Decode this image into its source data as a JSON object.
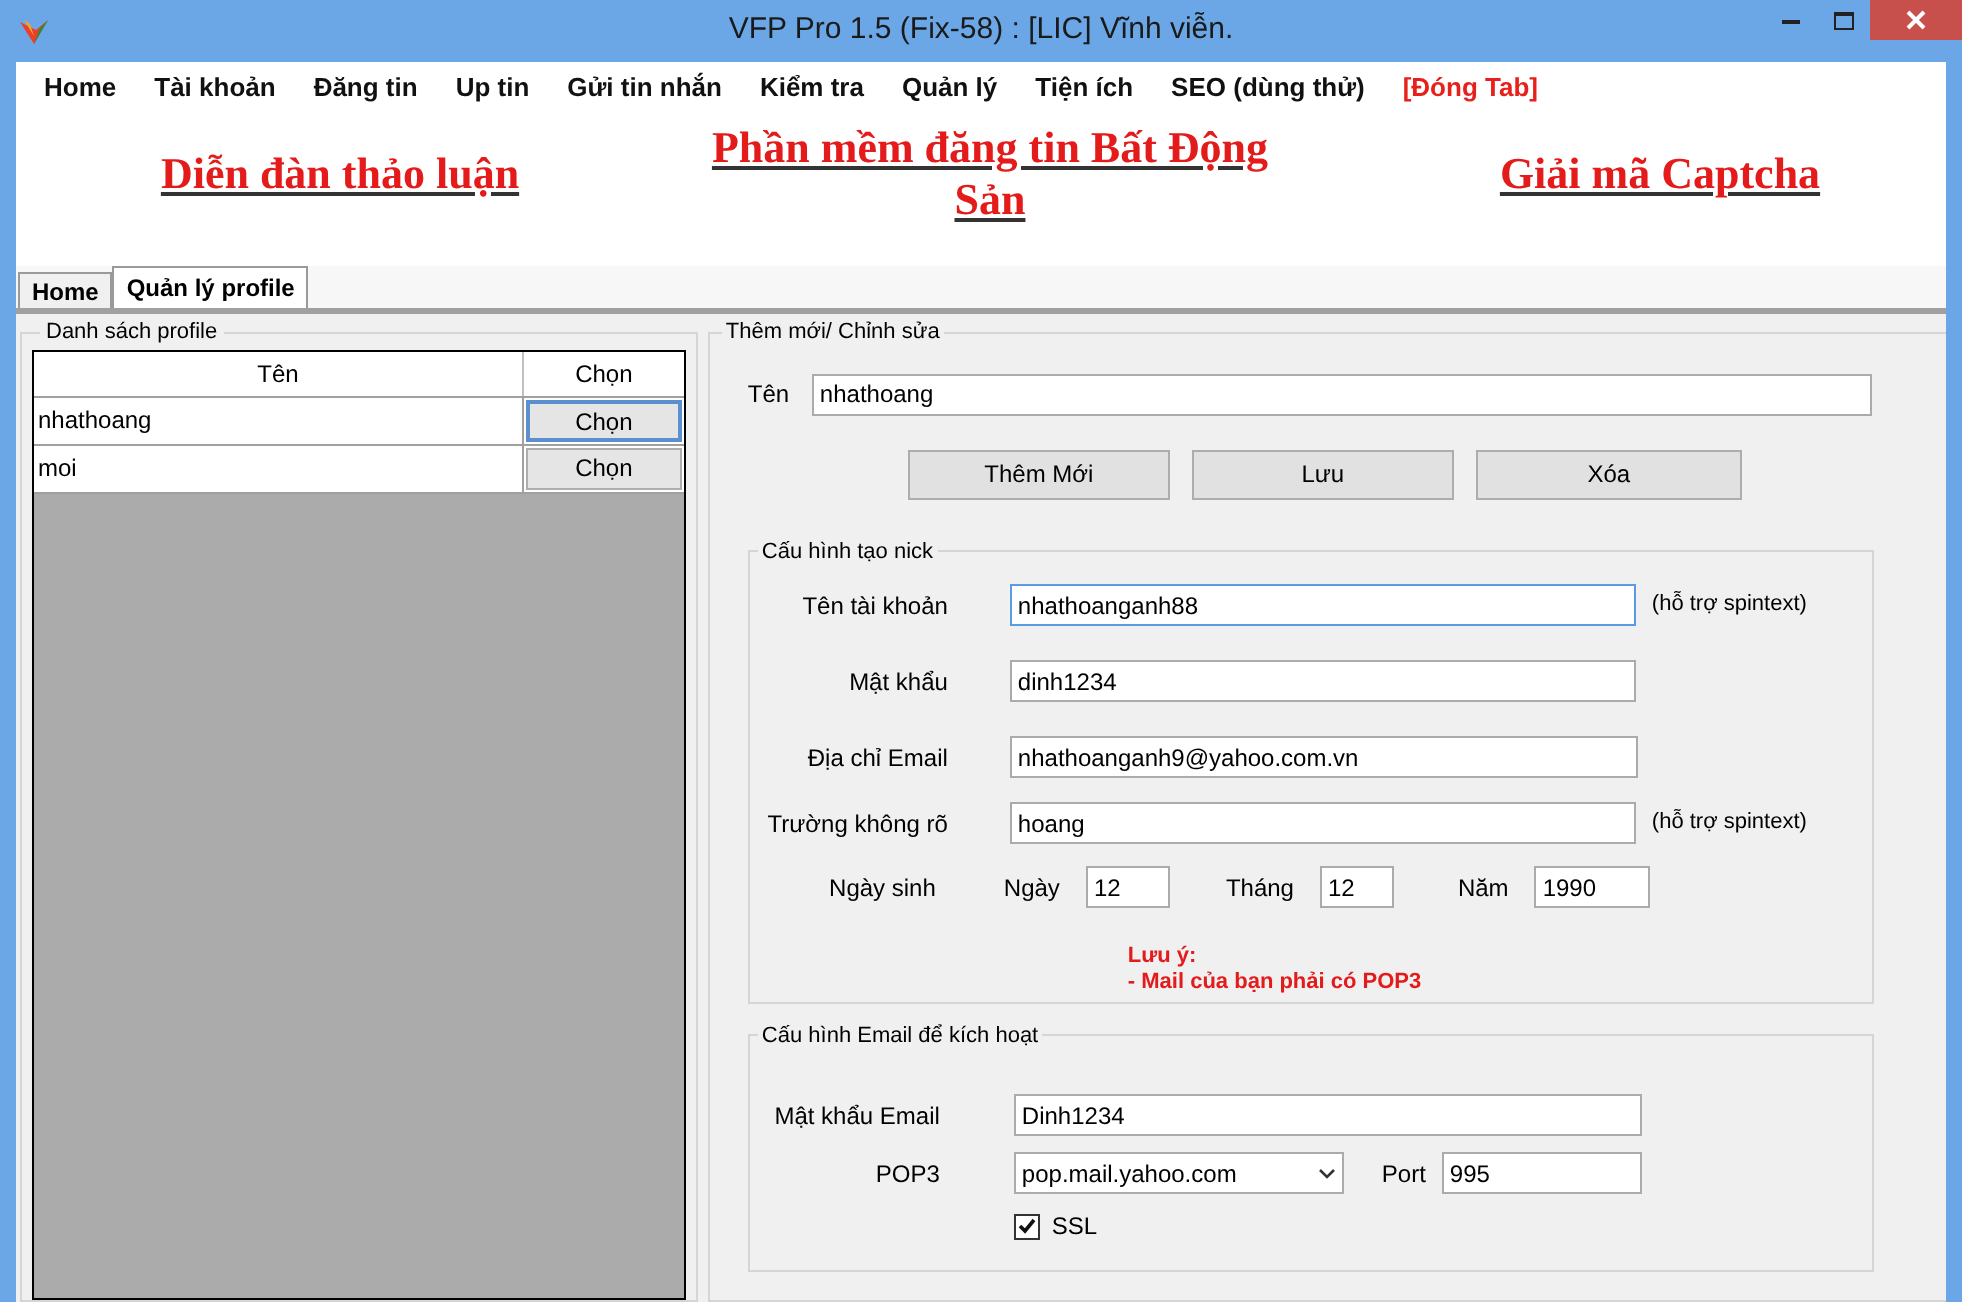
{
  "window": {
    "title": "VFP Pro 1.5 (Fix-58) : [LIC] Vĩnh viễn."
  },
  "menu": [
    {
      "label": "Home",
      "kind": "normal"
    },
    {
      "label": "Tài khoản",
      "kind": "normal"
    },
    {
      "label": "Đăng tin",
      "kind": "normal"
    },
    {
      "label": "Up tin",
      "kind": "normal"
    },
    {
      "label": "Gửi tin nhắn",
      "kind": "normal"
    },
    {
      "label": "Kiểm tra",
      "kind": "normal"
    },
    {
      "label": "Quản lý",
      "kind": "normal"
    },
    {
      "label": "Tiện ích",
      "kind": "normal"
    },
    {
      "label": "SEO (dùng thử)",
      "kind": "normal"
    },
    {
      "label": "[Đóng Tab]",
      "kind": "highlight"
    }
  ],
  "banner_links": [
    "Diễn đàn thảo luận",
    "Phần mềm đăng tin Bất Động Sản",
    "Giải mã Captcha"
  ],
  "tabs": [
    {
      "label": "Home",
      "selected": false
    },
    {
      "label": "Quản lý profile",
      "selected": true
    }
  ],
  "profile_list": {
    "title": "Danh sách profile",
    "columns": [
      "Tên",
      "Chọn"
    ],
    "rows": [
      {
        "name": "nhathoang",
        "button": "Chọn",
        "selected": true
      },
      {
        "name": "moi",
        "button": "Chọn",
        "selected": false
      }
    ]
  },
  "edit_group": {
    "title": "Thêm mới/ Chỉnh sửa",
    "name_label": "Tên",
    "name_value": "nhathoang",
    "buttons": [
      "Thêm Mới",
      "Lưu",
      "Xóa"
    ],
    "nick_config": {
      "title": "Cấu hình tạo nick",
      "fields": [
        {
          "label": "Tên tài khoản",
          "value": "nhathoanganh88",
          "hint": "(hỗ trợ spintext)",
          "focused": true
        },
        {
          "label": "Mật khẩu",
          "value": "dinh1234",
          "focused": false
        },
        {
          "label": "Địa chỉ Email",
          "value": "nhathoanganh9@yahoo.com.vn",
          "focused": false
        },
        {
          "label": "Trường không rõ",
          "value": "hoang",
          "hint": "(hỗ trợ spintext)",
          "focused": false
        }
      ],
      "birth": {
        "label": "Ngày sinh",
        "parts": [
          {
            "label": "Ngày",
            "value": "12"
          },
          {
            "label": "Tháng",
            "value": "12"
          },
          {
            "label": "Năm",
            "value": "1990"
          }
        ]
      },
      "note_lines": [
        "Lưu ý:",
        "- Mail của bạn phải có POP3"
      ]
    },
    "email_config": {
      "title": "Cấu hình Email để kích hoạt",
      "password": {
        "label": "Mật khẩu Email",
        "value": "Dinh1234"
      },
      "pop3": {
        "label": "POP3",
        "value": "pop.mail.yahoo.com"
      },
      "port": {
        "label": "Port",
        "value": "995"
      },
      "ssl": {
        "label": "SSL",
        "checked": true
      }
    }
  }
}
